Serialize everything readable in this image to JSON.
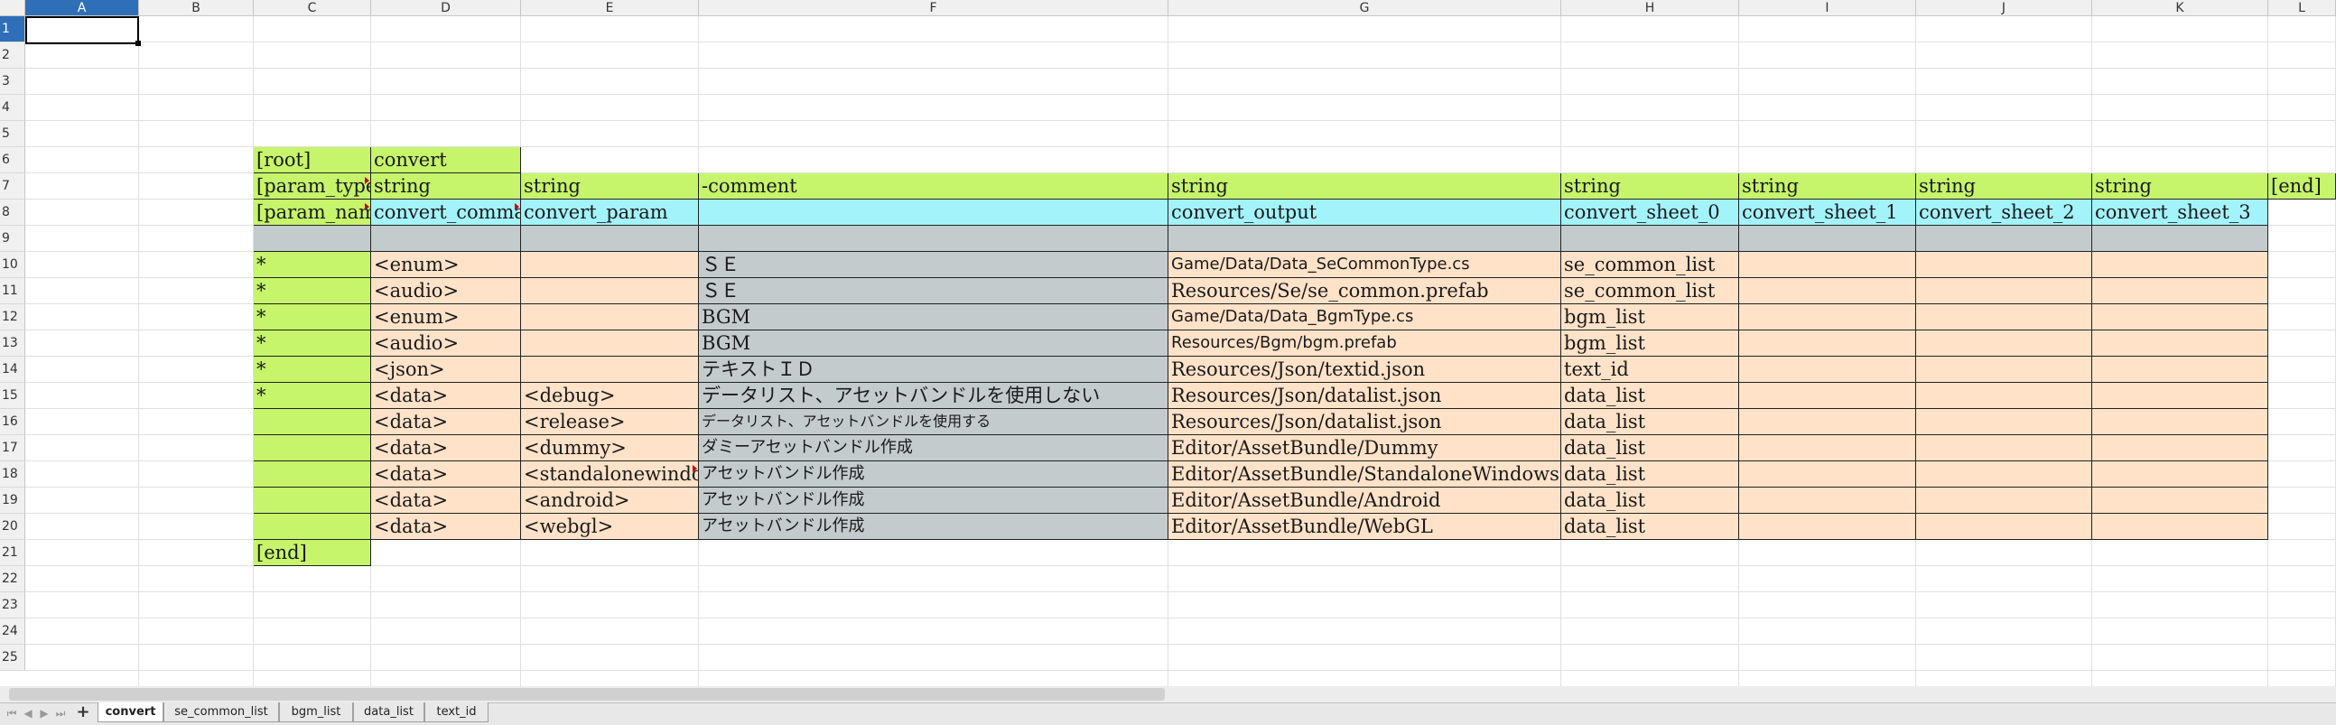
{
  "columns": [
    "A",
    "B",
    "C",
    "D",
    "E",
    "F",
    "G",
    "H",
    "I",
    "J",
    "K",
    "L"
  ],
  "rows": [
    "1",
    "2",
    "3",
    "4",
    "5",
    "6",
    "7",
    "8",
    "9",
    "10",
    "11",
    "12",
    "13",
    "14",
    "15",
    "16",
    "17",
    "18",
    "19",
    "20",
    "21",
    "22",
    "23",
    "24",
    "25"
  ],
  "cells": {
    "r6": {
      "c": "[root]",
      "d": "convert"
    },
    "r7": {
      "c": "[param_type]",
      "d": "string",
      "e": "string",
      "f": "-comment",
      "g": "string",
      "h": "string",
      "i": "string",
      "j": "string",
      "k": "string",
      "l": "[end]"
    },
    "r8": {
      "c": "[param_name]",
      "d": "convert_command",
      "e": "convert_param",
      "g": "convert_output",
      "h": "convert_sheet_0",
      "i": "convert_sheet_1",
      "j": "convert_sheet_2",
      "k": "convert_sheet_3"
    },
    "data_rows": [
      {
        "c": "*",
        "d": "<enum>",
        "e": "",
        "f": "ＳＥ",
        "g": "Game/Data/Data_SeCommonType.cs",
        "h": "se_common_list"
      },
      {
        "c": "*",
        "d": "<audio>",
        "e": "",
        "f": "ＳＥ",
        "g": "Resources/Se/se_common.prefab",
        "h": "se_common_list"
      },
      {
        "c": "*",
        "d": "<enum>",
        "e": "",
        "f": "BGM",
        "g": "Game/Data/Data_BgmType.cs",
        "h": "bgm_list"
      },
      {
        "c": "*",
        "d": "<audio>",
        "e": "",
        "f": "BGM",
        "g": "Resources/Bgm/bgm.prefab",
        "h": "bgm_list"
      },
      {
        "c": "*",
        "d": "<json>",
        "e": "",
        "f": "テキストＩＤ",
        "g": "Resources/Json/textid.json",
        "h": "text_id"
      },
      {
        "c": "*",
        "d": "<data>",
        "e": "<debug>",
        "f": "データリスト、アセットバンドルを使用しない",
        "g": "Resources/Json/datalist.json",
        "h": "data_list"
      },
      {
        "c": "",
        "d": "<data>",
        "e": "<release>",
        "f": "データリスト、アセットバンドルを使用する",
        "g": "Resources/Json/datalist.json",
        "h": "data_list"
      },
      {
        "c": "",
        "d": "<data>",
        "e": "<dummy>",
        "f": "ダミーアセットバンドル作成",
        "g": "Editor/AssetBundle/Dummy",
        "h": "data_list"
      },
      {
        "c": "",
        "d": "<data>",
        "e": "<standalonewindows>",
        "f": "アセットバンドル作成",
        "g": "Editor/AssetBundle/StandaloneWindows",
        "h": "data_list"
      },
      {
        "c": "",
        "d": "<data>",
        "e": "<android>",
        "f": "アセットバンドル作成",
        "g": "Editor/AssetBundle/Android",
        "h": "data_list"
      },
      {
        "c": "",
        "d": "<data>",
        "e": "<webgl>",
        "f": "アセットバンドル作成",
        "g": "Editor/AssetBundle/WebGL",
        "h": "data_list"
      }
    ],
    "r21": {
      "c": "[end]"
    }
  },
  "tabs": [
    {
      "label": "convert",
      "active": true
    },
    {
      "label": "se_common_list",
      "active": false
    },
    {
      "label": "bgm_list",
      "active": false
    },
    {
      "label": "data_list",
      "active": false
    },
    {
      "label": "text_id",
      "active": false
    }
  ],
  "tab_nav": {
    "first": "⏮",
    "prev": "◀",
    "next": "▶",
    "last": "⏭",
    "add": "+"
  },
  "colors": {
    "green": "#c6f46b",
    "cyan": "#a3f3fb",
    "grey": "#c4cbcc",
    "peach": "#ffe2c8",
    "selection": "#2f6fb7"
  }
}
